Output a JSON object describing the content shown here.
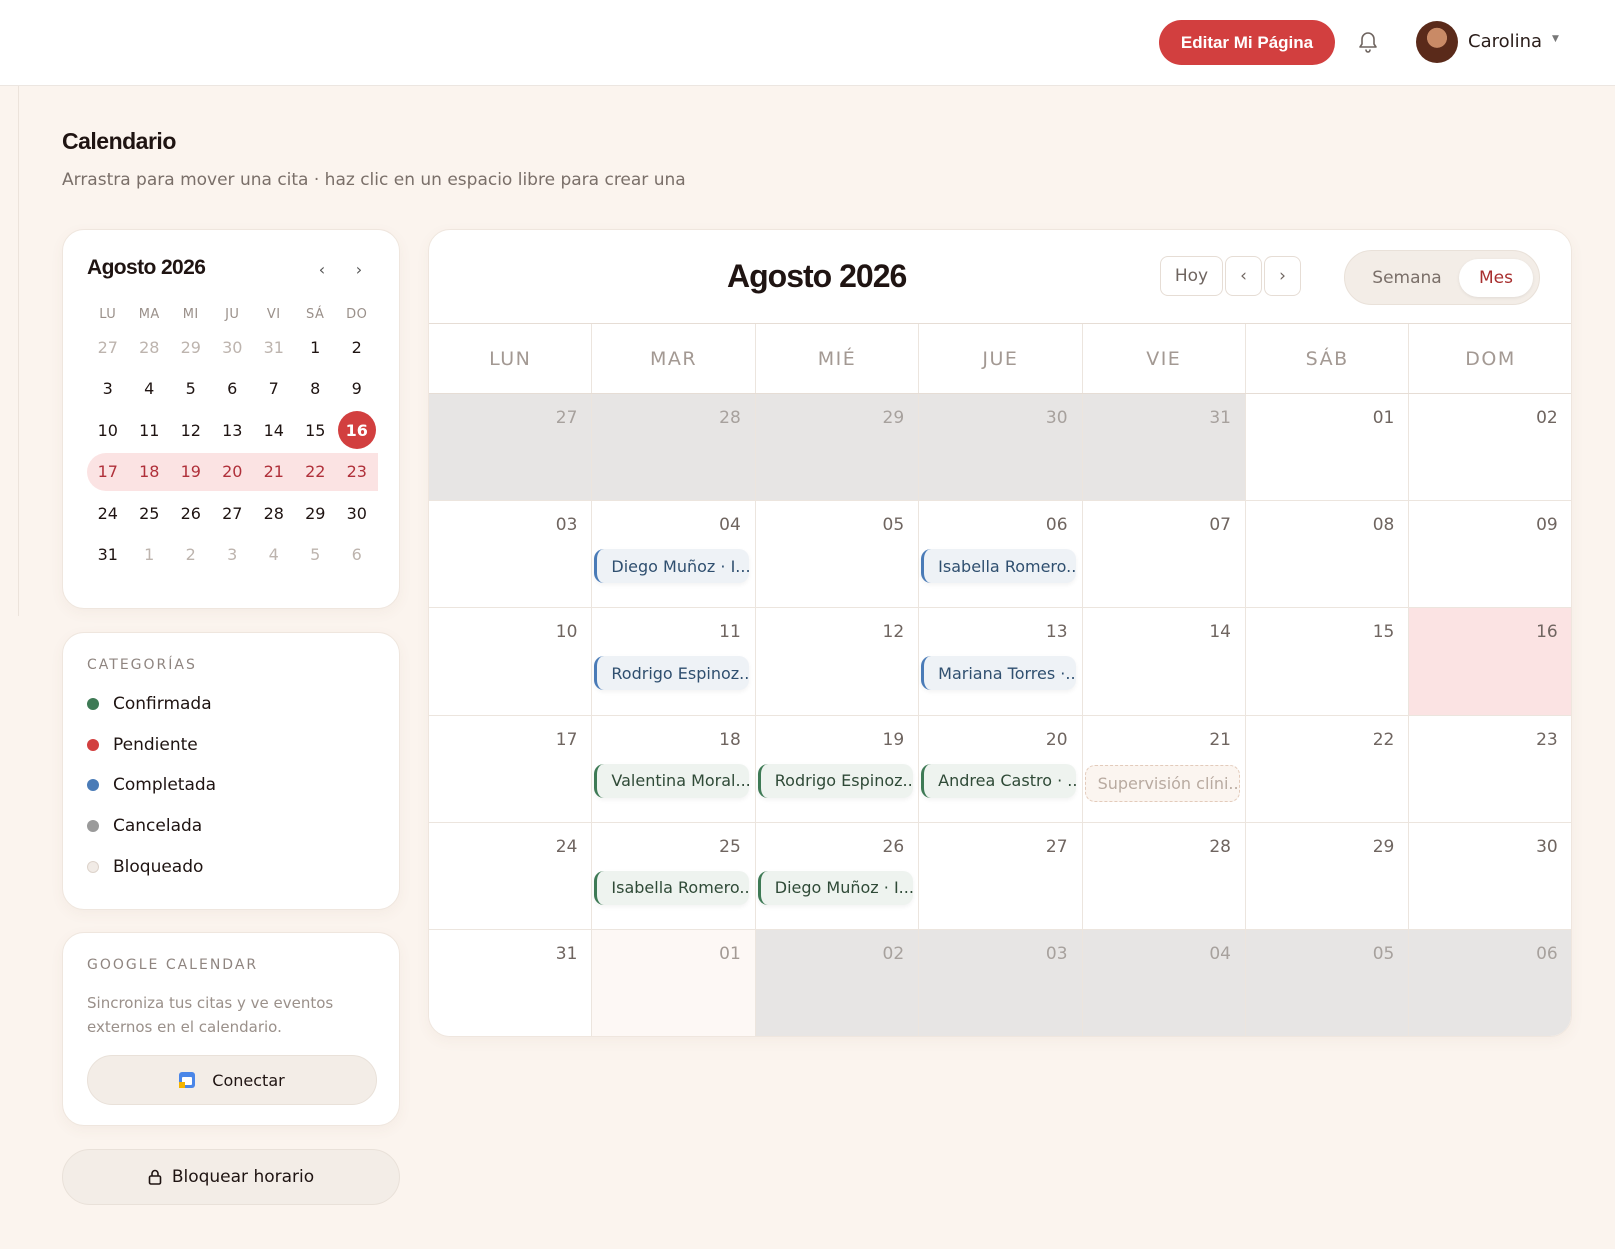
{
  "header": {
    "edit_button": "Editar Mi Página",
    "user_name": "Carolina"
  },
  "page": {
    "title": "Calendario",
    "subtitle": "Arrastra para mover una cita · haz clic en un espacio libre para crear una"
  },
  "mini_calendar": {
    "title": "Agosto 2026",
    "prev": "‹",
    "next": "›",
    "weekdays": [
      "LU",
      "MA",
      "MI",
      "JU",
      "VI",
      "SÁ",
      "DO"
    ],
    "days": [
      {
        "n": "27",
        "s": "muted"
      },
      {
        "n": "28",
        "s": "muted"
      },
      {
        "n": "29",
        "s": "muted"
      },
      {
        "n": "30",
        "s": "muted"
      },
      {
        "n": "31",
        "s": "muted"
      },
      {
        "n": "1",
        "s": ""
      },
      {
        "n": "2",
        "s": ""
      },
      {
        "n": "3",
        "s": ""
      },
      {
        "n": "4",
        "s": ""
      },
      {
        "n": "5",
        "s": ""
      },
      {
        "n": "6",
        "s": ""
      },
      {
        "n": "7",
        "s": ""
      },
      {
        "n": "8",
        "s": ""
      },
      {
        "n": "9",
        "s": ""
      },
      {
        "n": "10",
        "s": ""
      },
      {
        "n": "11",
        "s": ""
      },
      {
        "n": "12",
        "s": ""
      },
      {
        "n": "13",
        "s": ""
      },
      {
        "n": "14",
        "s": ""
      },
      {
        "n": "15",
        "s": ""
      },
      {
        "n": "16",
        "s": "today"
      },
      {
        "n": "17",
        "s": "week first"
      },
      {
        "n": "18",
        "s": "week"
      },
      {
        "n": "19",
        "s": "week"
      },
      {
        "n": "20",
        "s": "week"
      },
      {
        "n": "21",
        "s": "week"
      },
      {
        "n": "22",
        "s": "week"
      },
      {
        "n": "23",
        "s": "week"
      },
      {
        "n": "24",
        "s": ""
      },
      {
        "n": "25",
        "s": ""
      },
      {
        "n": "26",
        "s": ""
      },
      {
        "n": "27",
        "s": ""
      },
      {
        "n": "28",
        "s": ""
      },
      {
        "n": "29",
        "s": ""
      },
      {
        "n": "30",
        "s": ""
      },
      {
        "n": "31",
        "s": ""
      },
      {
        "n": "1",
        "s": "muted"
      },
      {
        "n": "2",
        "s": "muted"
      },
      {
        "n": "3",
        "s": "muted"
      },
      {
        "n": "4",
        "s": "muted"
      },
      {
        "n": "5",
        "s": "muted"
      },
      {
        "n": "6",
        "s": "muted"
      }
    ]
  },
  "categories": {
    "label": "CATEGORÍAS",
    "items": [
      {
        "label": "Confirmada",
        "color": "#3e7a55"
      },
      {
        "label": "Pendiente",
        "color": "#d23f3f"
      },
      {
        "label": "Completada",
        "color": "#4a7bb7"
      },
      {
        "label": "Cancelada",
        "color": "#9a9a9a"
      },
      {
        "label": "Bloqueado",
        "color": "#f1ebe6"
      }
    ]
  },
  "google": {
    "label": "GOOGLE CALENDAR",
    "description": "Sincroniza tus citas y ve eventos externos en el calendario.",
    "connect": "Conectar"
  },
  "block_button": "Bloquear horario",
  "main_calendar": {
    "title": "Agosto 2026",
    "today": "Hoy",
    "prev": "‹",
    "next": "›",
    "view_week": "Semana",
    "view_month": "Mes",
    "weekdays": [
      "LUN",
      "MAR",
      "MIÉ",
      "JUE",
      "VIE",
      "SÁB",
      "DOM"
    ],
    "cells": [
      {
        "n": "27",
        "s": "out"
      },
      {
        "n": "28",
        "s": "out"
      },
      {
        "n": "29",
        "s": "out"
      },
      {
        "n": "30",
        "s": "out"
      },
      {
        "n": "31",
        "s": "out"
      },
      {
        "n": "01",
        "s": ""
      },
      {
        "n": "02",
        "s": ""
      },
      {
        "n": "03",
        "s": ""
      },
      {
        "n": "04",
        "s": "",
        "event": {
          "text": "Diego Muñoz · I...",
          "kind": "blue"
        }
      },
      {
        "n": "05",
        "s": ""
      },
      {
        "n": "06",
        "s": "",
        "event": {
          "text": "Isabella Romero...",
          "kind": "blue"
        }
      },
      {
        "n": "07",
        "s": ""
      },
      {
        "n": "08",
        "s": ""
      },
      {
        "n": "09",
        "s": ""
      },
      {
        "n": "10",
        "s": ""
      },
      {
        "n": "11",
        "s": "",
        "event": {
          "text": "Rodrigo Espinoz...",
          "kind": "blue"
        }
      },
      {
        "n": "12",
        "s": ""
      },
      {
        "n": "13",
        "s": "",
        "event": {
          "text": "Mariana Torres ·...",
          "kind": "blue"
        }
      },
      {
        "n": "14",
        "s": ""
      },
      {
        "n": "15",
        "s": ""
      },
      {
        "n": "16",
        "s": "today"
      },
      {
        "n": "17",
        "s": ""
      },
      {
        "n": "18",
        "s": "",
        "event": {
          "text": "Valentina Moral...",
          "kind": "green"
        }
      },
      {
        "n": "19",
        "s": "",
        "event": {
          "text": "Rodrigo Espinoz...",
          "kind": "green"
        }
      },
      {
        "n": "20",
        "s": "",
        "event": {
          "text": "Andrea Castro · ...",
          "kind": "green"
        }
      },
      {
        "n": "21",
        "s": "",
        "event": {
          "text": "Supervisión clíni...",
          "kind": "blocked"
        }
      },
      {
        "n": "22",
        "s": ""
      },
      {
        "n": "23",
        "s": ""
      },
      {
        "n": "24",
        "s": ""
      },
      {
        "n": "25",
        "s": "",
        "event": {
          "text": "Isabella Romero...",
          "kind": "green"
        }
      },
      {
        "n": "26",
        "s": "",
        "event": {
          "text": "Diego Muñoz · I...",
          "kind": "green"
        }
      },
      {
        "n": "27",
        "s": ""
      },
      {
        "n": "28",
        "s": ""
      },
      {
        "n": "29",
        "s": ""
      },
      {
        "n": "30",
        "s": ""
      },
      {
        "n": "31",
        "s": ""
      },
      {
        "n": "01",
        "s": "soft"
      },
      {
        "n": "02",
        "s": "out"
      },
      {
        "n": "03",
        "s": "out"
      },
      {
        "n": "04",
        "s": "out"
      },
      {
        "n": "05",
        "s": "out"
      },
      {
        "n": "06",
        "s": "out"
      }
    ]
  }
}
